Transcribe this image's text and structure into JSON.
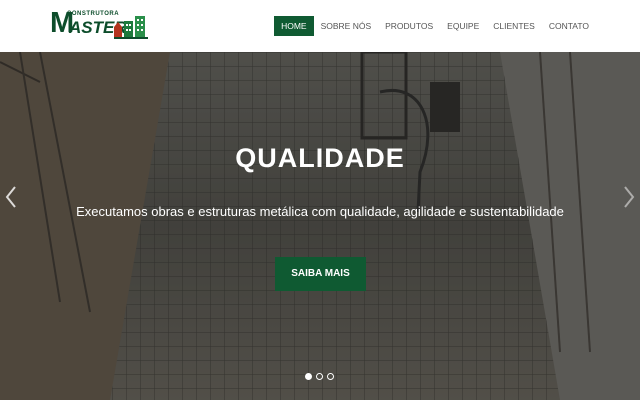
{
  "logo": {
    "small_text": "CONSTRUTORA",
    "letter": "M",
    "big_text": "ASTER"
  },
  "nav": {
    "items": [
      {
        "label": "HOME",
        "active": true
      },
      {
        "label": "SOBRE NÓS",
        "active": false
      },
      {
        "label": "PRODUTOS",
        "active": false
      },
      {
        "label": "EQUIPE",
        "active": false
      },
      {
        "label": "CLIENTES",
        "active": false
      },
      {
        "label": "CONTATO",
        "active": false
      }
    ]
  },
  "hero": {
    "title": "QUALIDADE",
    "subtitle": "Executamos obras e estruturas metálica com qualidade, agilidade e sustentabilidade",
    "button_label": "SAIBA MAIS",
    "slides_count": 3,
    "active_slide": 1
  },
  "colors": {
    "brand_green": "#0f5a32",
    "logo_green": "#0d4d2b",
    "nav_text": "#555555"
  }
}
